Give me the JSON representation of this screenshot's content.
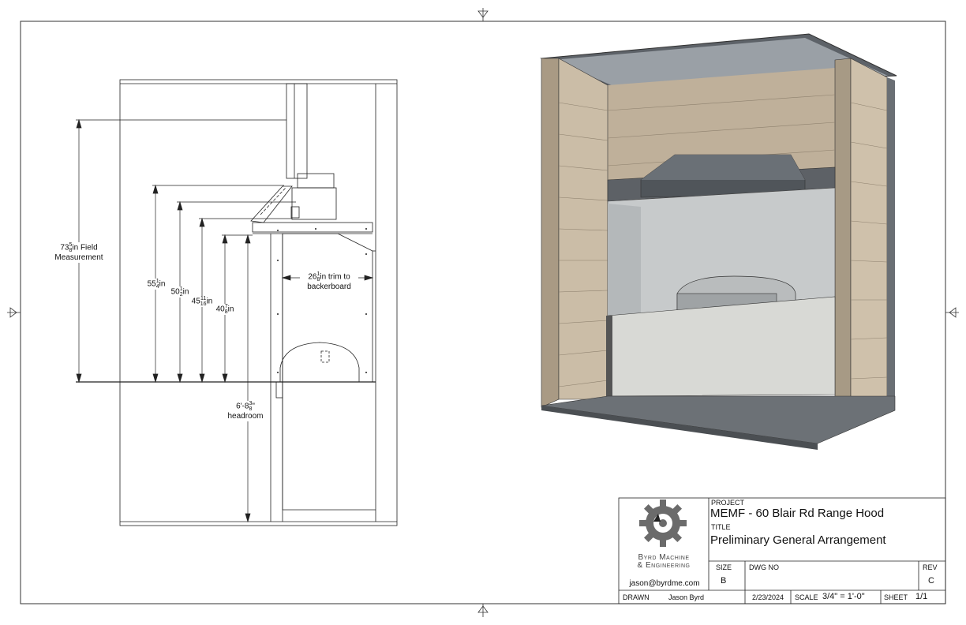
{
  "drawing": {
    "dims": {
      "field": {
        "whole": "73",
        "num": "5",
        "den": "8",
        "unit": "in Field",
        "line2": "Measurement"
      },
      "d55": {
        "whole": "55",
        "num": "1",
        "den": "4",
        "unit": "in"
      },
      "d50": {
        "whole": "50",
        "num": "1",
        "den": "2",
        "unit": "in"
      },
      "d45": {
        "whole": "45",
        "num": "11",
        "den": "16",
        "unit": "in"
      },
      "d40": {
        "whole": "40",
        "num": "7",
        "den": "8",
        "unit": "in"
      },
      "trim": {
        "whole": "26",
        "num": "1",
        "den": "8",
        "unit": "in trim to",
        "line2": "backerboard"
      },
      "headroom": {
        "whole": "6'-8",
        "num": "3",
        "den": "8",
        "unit": "\"",
        "line2": "headroom"
      }
    }
  },
  "title_block": {
    "company_line1": "Byrd Machine",
    "company_line2": "& Engineering",
    "email": "jason@byrdme.com",
    "project_label": "PROJECT",
    "project": "MEMF - 60 Blair Rd Range Hood",
    "title_label": "TITLE",
    "title": "Preliminary General Arrangement",
    "size_label": "SIZE",
    "size": "B",
    "dwg_label": "DWG NO",
    "dwg": "",
    "rev_label": "REV",
    "rev": "C",
    "drawn_label": "DRAWN",
    "drawn_by": "Jason Byrd",
    "date": "2/23/2024",
    "scale_label": "SCALE",
    "scale": "3/4\" = 1'-0\"",
    "sheet_label": "SHEET",
    "sheet": "1/1"
  },
  "colors": {
    "brick": "#c8bba6",
    "steel": "#4a4f55",
    "panel": "#d4d6d3",
    "floor": "#6f7479"
  }
}
